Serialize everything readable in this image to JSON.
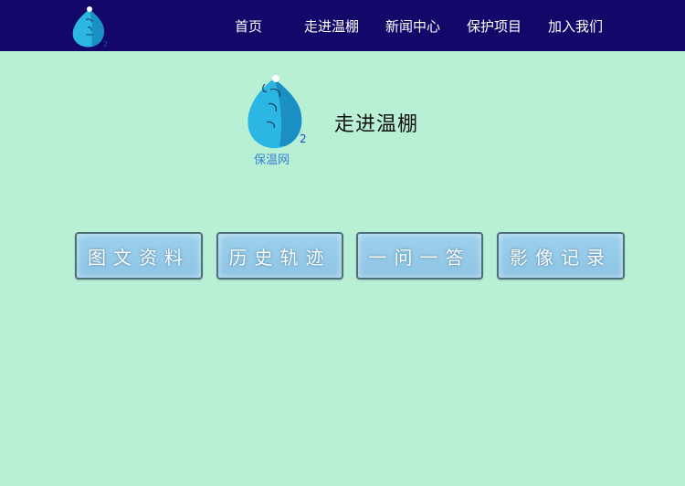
{
  "nav": {
    "items": [
      {
        "label": "首页"
      },
      {
        "label": "走进温棚"
      },
      {
        "label": "新闻中心"
      },
      {
        "label": "保护项目"
      },
      {
        "label": "加入我们"
      }
    ]
  },
  "hero": {
    "logo_caption": "保温网",
    "title": "走进温棚"
  },
  "cards": [
    {
      "label": "图文资料"
    },
    {
      "label": "历史轨迹"
    },
    {
      "label": "一问一答"
    },
    {
      "label": "影像记录"
    }
  ],
  "colors": {
    "topbar": "#13086a",
    "background": "#b8f0d6",
    "card": "#93c9e8",
    "card_border": "#4e6f78",
    "logo_blue": "#2cb6e4"
  }
}
